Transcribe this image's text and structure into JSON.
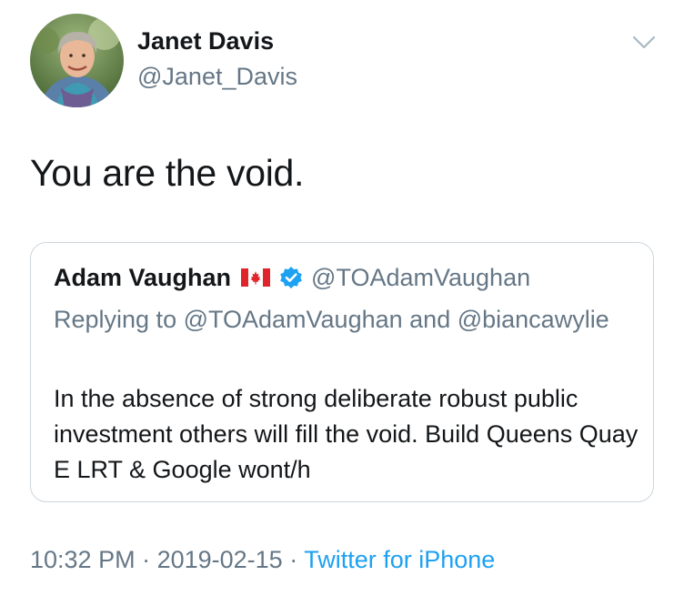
{
  "author": {
    "display_name": "Janet Davis",
    "handle": "@Janet_Davis",
    "avatar_icon": "profile-photo"
  },
  "menu": {
    "icon": "chevron-down-icon"
  },
  "tweet": {
    "text": "You are the void."
  },
  "quoted_tweet": {
    "display_name": "Adam Vaughan",
    "flag_icon": "canada-flag-icon",
    "verified_icon": "verified-badge-icon",
    "handle": "@TOAdamVaughan",
    "replying_prefix": "Replying to ",
    "replying_to_1": "@TOAdamVaughan",
    "replying_and": " and ",
    "replying_to_2": "@biancawylie",
    "text": "In the absence of strong deliberate robust public investment others will fill the void. Build Queens Quay E LRT & Google wont/h"
  },
  "meta": {
    "time": "10:32 PM",
    "separator": " · ",
    "date": "2019-02-15",
    "source": "Twitter for iPhone"
  },
  "colors": {
    "primary_text": "#14171a",
    "secondary_text": "#657786",
    "link": "#1da1f2",
    "border": "#ccd6dd",
    "canada_red": "#e0242b"
  }
}
